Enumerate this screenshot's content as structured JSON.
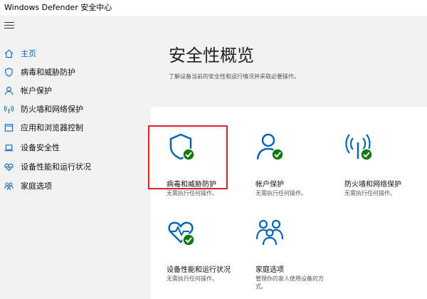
{
  "window": {
    "title": "Windows Defender 安全中心"
  },
  "sidebar": {
    "items": [
      {
        "label": "主页",
        "icon": "home-icon"
      },
      {
        "label": "病毒和威胁防护",
        "icon": "shield-icon"
      },
      {
        "label": "帐户保护",
        "icon": "person-icon"
      },
      {
        "label": "防火墙和网络保护",
        "icon": "wifi-icon"
      },
      {
        "label": "应用和浏览器控制",
        "icon": "browser-icon"
      },
      {
        "label": "设备安全性",
        "icon": "laptop-icon"
      },
      {
        "label": "设备性能和运行状况",
        "icon": "heart-icon"
      },
      {
        "label": "家庭选项",
        "icon": "family-icon"
      }
    ]
  },
  "main": {
    "title": "安全性概览",
    "subtitle": "了解设备当前的安全性和运行情况并采取必要操作。",
    "tiles": [
      {
        "title": "病毒和威胁防护",
        "desc": "无需执行任何操作。",
        "icon": "shield-check-icon"
      },
      {
        "title": "帐户保护",
        "desc": "无需执行任何操作。",
        "icon": "person-check-icon"
      },
      {
        "title": "防火墙和网络保护",
        "desc": "无需执行任何操作。",
        "icon": "wifi-check-icon"
      },
      {
        "title": "设备性能和运行状况",
        "desc": "无需执行任何操作。",
        "icon": "heart-check-icon"
      },
      {
        "title": "家庭选项",
        "desc_line1": "管理你的家人使用设备的方",
        "desc_line2": "式。",
        "icon": "family-icon"
      }
    ]
  },
  "colors": {
    "accent": "#0067c0",
    "ok": "#0f7b0f",
    "highlight": "#d9242a"
  }
}
